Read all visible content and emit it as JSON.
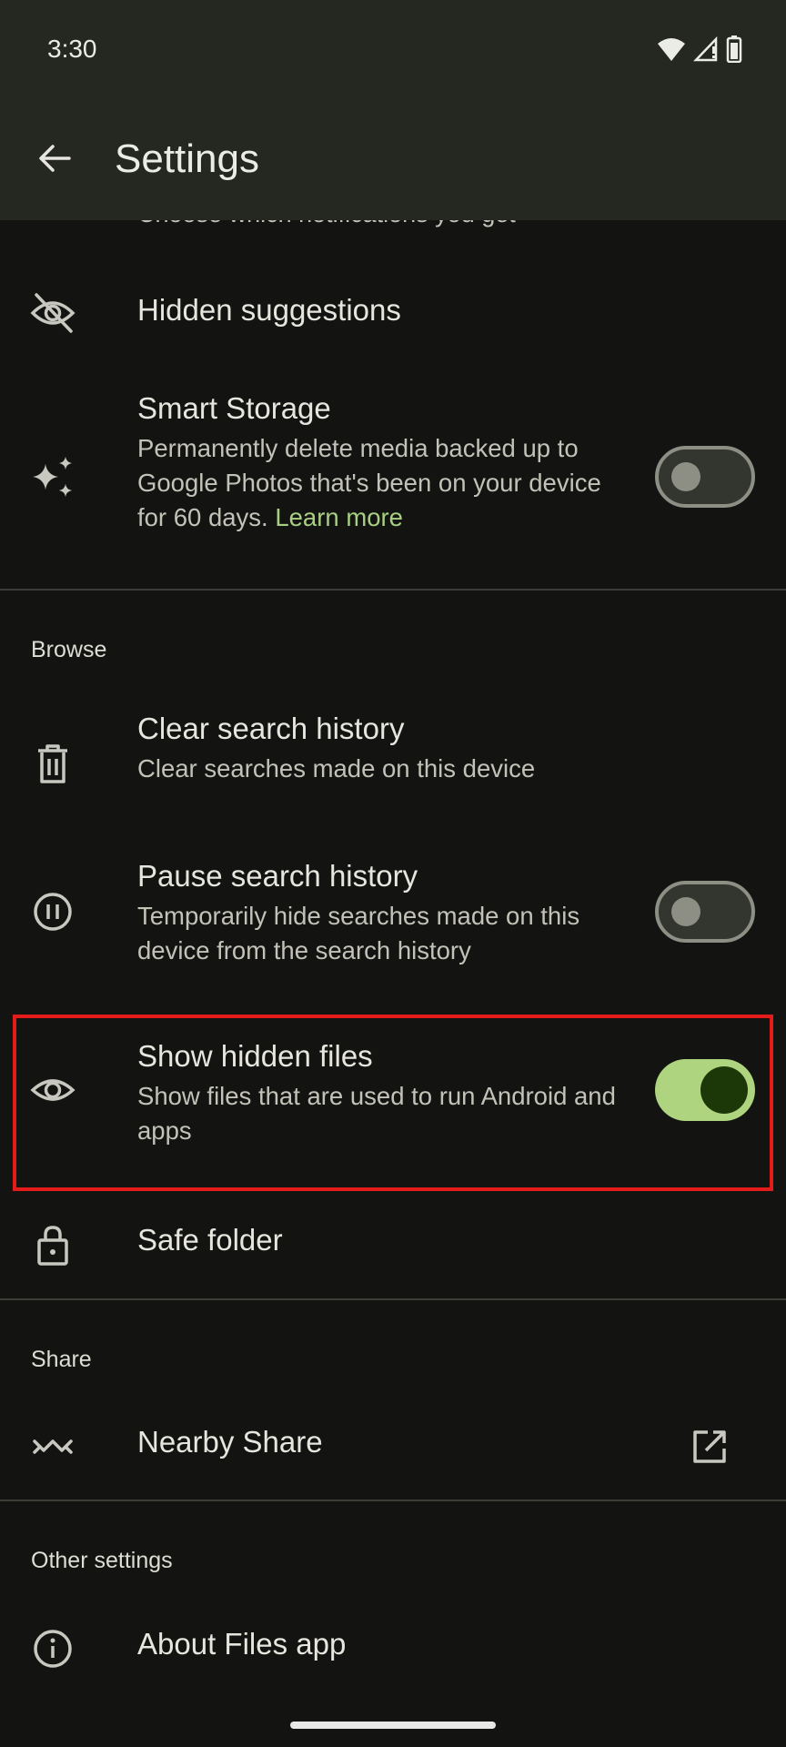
{
  "status_bar": {
    "time": "3:30",
    "icons": [
      "wifi-icon",
      "signal-icon",
      "battery-icon"
    ]
  },
  "app_bar": {
    "title": "Settings",
    "back_icon": "arrow-back-icon"
  },
  "scrolled_partial_text": "Choose which notifications you get",
  "items": {
    "hidden_suggestions": {
      "title": "Hidden suggestions",
      "icon": "eye-off-icon"
    },
    "smart_storage": {
      "title": "Smart Storage",
      "subtitle": "Permanently delete media backed up to Google Photos that's been on your device for 60 days.",
      "link": "Learn more",
      "icon": "sparkle-icon",
      "toggle_on": false
    },
    "clear_search_history": {
      "title": "Clear search history",
      "subtitle": "Clear searches made on this device",
      "icon": "trash-icon"
    },
    "pause_search_history": {
      "title": "Pause search history",
      "subtitle": "Temporarily hide searches made on this device from the search history",
      "icon": "pause-circle-icon",
      "toggle_on": false
    },
    "show_hidden_files": {
      "title": "Show hidden files",
      "subtitle": "Show files that are used to run Android and apps",
      "icon": "eye-icon",
      "toggle_on": true
    },
    "safe_folder": {
      "title": "Safe folder",
      "icon": "lock-icon"
    },
    "nearby_share": {
      "title": "Nearby Share",
      "icon": "nearby-share-icon",
      "action_icon": "open-external-icon"
    },
    "about_files_app": {
      "title": "About Files app",
      "icon": "info-icon"
    }
  },
  "sections": {
    "browse": "Browse",
    "share": "Share",
    "other_settings": "Other settings"
  },
  "colors": {
    "background": "#131411",
    "app_bar": "#252721",
    "accent": "#afd47f",
    "link": "#a8cf84",
    "highlight_border": "#e41b1b"
  }
}
